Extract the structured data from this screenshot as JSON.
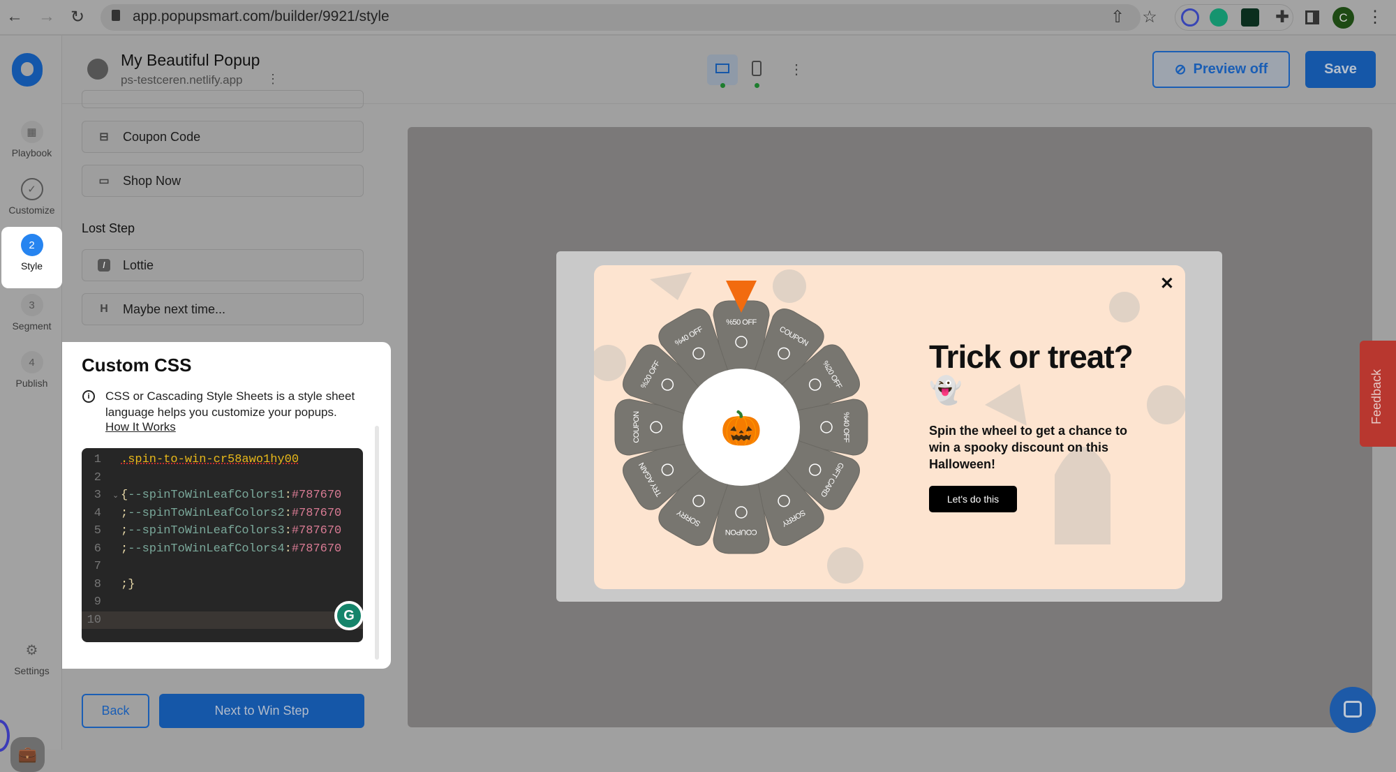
{
  "browser": {
    "url": "app.popupsmart.com/builder/9921/style",
    "profile_initial": "C"
  },
  "header": {
    "title": "My Beautiful Popup",
    "domain": "ps-testceren.netlify.app",
    "preview_label": "Preview off",
    "save_label": "Save"
  },
  "sidebar": {
    "items": [
      {
        "label": "Playbook",
        "badge": ""
      },
      {
        "label": "Customize",
        "badge": ""
      },
      {
        "label": "Style",
        "badge": "2"
      },
      {
        "label": "Segment",
        "badge": "3"
      },
      {
        "label": "Publish",
        "badge": "4"
      }
    ],
    "settings_label": "Settings"
  },
  "panel": {
    "elements": [
      {
        "label": "Coupon Code",
        "icon": "ticket-icon"
      },
      {
        "label": "Shop Now",
        "icon": "button-icon"
      }
    ],
    "lost_step_title": "Lost Step",
    "lost_elements": [
      {
        "label": "Lottie",
        "icon": "lottie-icon"
      },
      {
        "label": "Maybe next time...",
        "icon": "heading-icon",
        "glyph": "H"
      }
    ],
    "custom_css": {
      "title": "Custom CSS",
      "description": "CSS or Cascading Style Sheets is a style sheet language helps you customize your popups.",
      "link": "How It Works",
      "code_lines": [
        {
          "n": "1",
          "text": ".spin-to-win-cr58awo1hy00"
        },
        {
          "n": "2",
          "text": ""
        },
        {
          "n": "3",
          "prefix": "{",
          "prop": "--spinToWinLeafColors1",
          "value": "#787670"
        },
        {
          "n": "4",
          "prefix": ";",
          "prop": "--spinToWinLeafColors2",
          "value": "#787670"
        },
        {
          "n": "5",
          "prefix": ";",
          "prop": "--spinToWinLeafColors3",
          "value": "#787670"
        },
        {
          "n": "6",
          "prefix": ";",
          "prop": "--spinToWinLeafColors4",
          "value": "#787670"
        },
        {
          "n": "7",
          "text": ""
        },
        {
          "n": "8",
          "text": ";}"
        },
        {
          "n": "9",
          "text": ""
        },
        {
          "n": "10",
          "text": ""
        }
      ]
    },
    "back_label": "Back",
    "next_label": "Next to Win Step"
  },
  "popup": {
    "title": "Trick or treat?",
    "emoji": "👻",
    "description": "Spin the wheel to get a chance to win a spooky discount on this Halloween!",
    "cta": "Let's do this",
    "center_emoji": "🎃",
    "wheel": [
      "%50 OFF",
      "COUPON",
      "%20 OFF",
      "%40 OFF",
      "GIFT CARD",
      "SORRY",
      "COUPON",
      "SORRY",
      "TRY AGAIN",
      "COUPON",
      "%20 OFF",
      "%40 OFF"
    ],
    "leaf_color": "#787670",
    "pointer_color": "#f26b0f",
    "background_color": "#fde4d0"
  },
  "feedback_label": "Feedback",
  "colors": {
    "primary": "#1557a8",
    "feedback": "#b8372f"
  }
}
